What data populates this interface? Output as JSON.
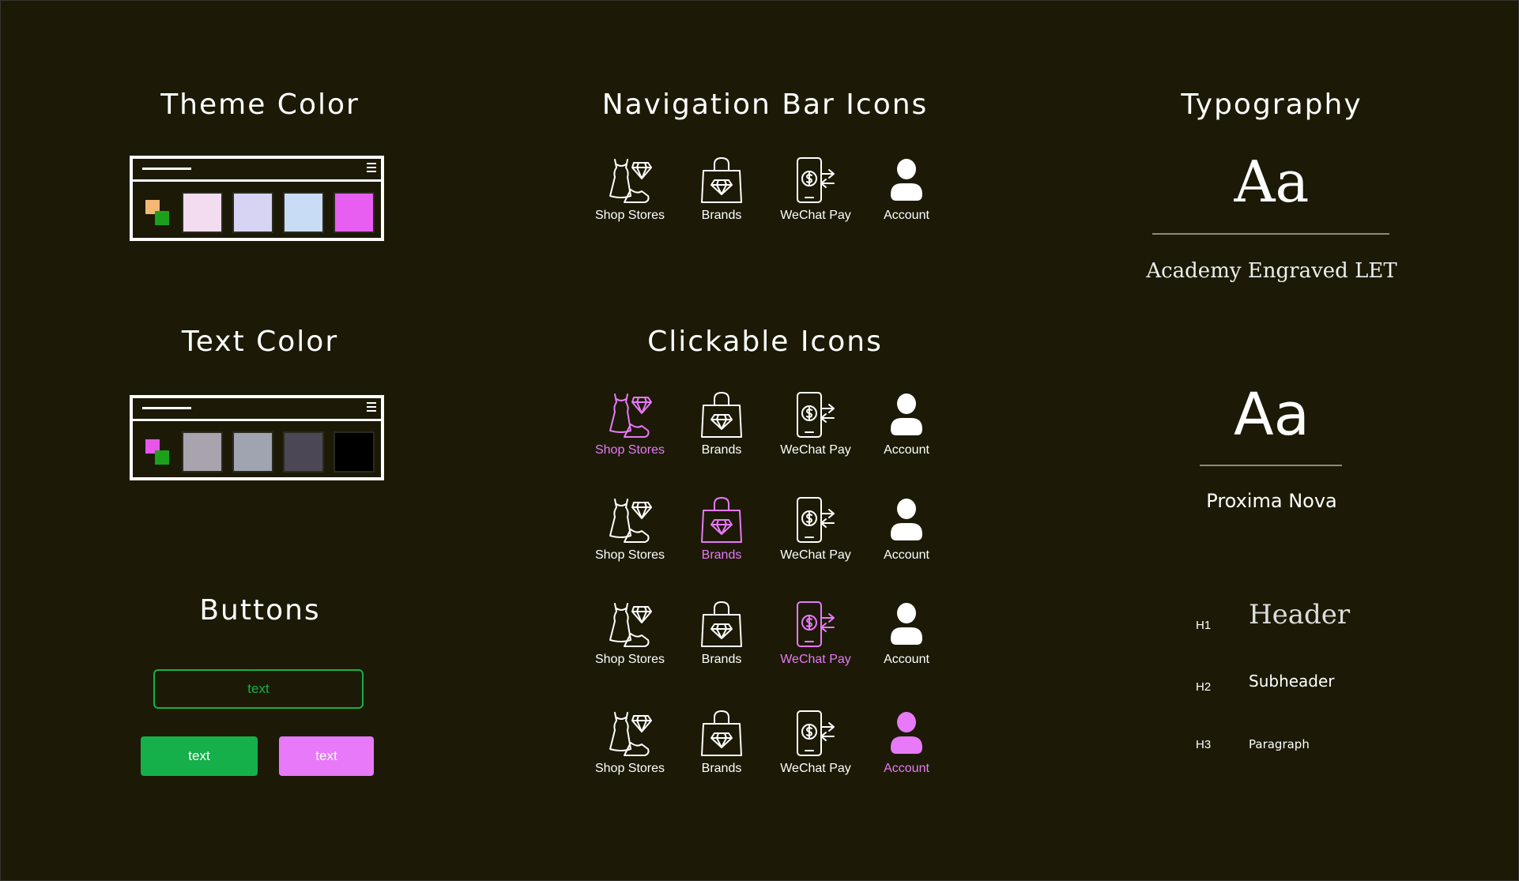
{
  "colors": {
    "background": "#1c1a06",
    "accent_pink": "#e879f9",
    "accent_green": "#16b04a",
    "white": "#ffffff"
  },
  "sections": {
    "theme_color": "Theme Color",
    "text_color": "Text Color",
    "buttons": "Buttons",
    "nav_icons": "Navigation Bar Icons",
    "clickable_icons": "Clickable Icons",
    "typography": "Typography"
  },
  "theme_palette": {
    "logo_color": "#f4b774",
    "swatches": [
      "#f3dcef",
      "#d6d4f2",
      "#c9dcf5",
      "#e85ef0"
    ]
  },
  "text_palette": {
    "logo_color": "#e855e8",
    "swatches": [
      "#a9a3ad",
      "#9fa4b0",
      "#4c4754",
      "#000000"
    ]
  },
  "buttons": {
    "outline_label": "text",
    "primary_label": "text",
    "secondary_label": "text"
  },
  "nav_icons": [
    {
      "label": "Shop Stores",
      "icon": "dress-shoe-icon"
    },
    {
      "label": "Brands",
      "icon": "diamond-bag-icon"
    },
    {
      "label": "WeChat Pay",
      "icon": "phone-pay-icon"
    },
    {
      "label": "Account",
      "icon": "person-icon"
    }
  ],
  "clickable_rows": [
    {
      "active": 0,
      "labels": [
        "Shop Stores",
        "Brands",
        "WeChat Pay",
        "Account"
      ]
    },
    {
      "active": 1,
      "labels": [
        "Shop Stores",
        "Brands",
        "WeChat Pay",
        "Account"
      ]
    },
    {
      "active": 2,
      "labels": [
        "Shop Stores",
        "Brands",
        "WeChat Pay",
        "Account"
      ]
    },
    {
      "active": 3,
      "labels": [
        "Shop Stores",
        "Brands",
        "WeChat Pay",
        "Account"
      ]
    }
  ],
  "typography": {
    "sample1": "Aa",
    "font1_name": "Academy Engraved LET",
    "sample2": "Aa",
    "font2_name": "Proxima Nova",
    "h1_label": "H1",
    "h1_text": "Header",
    "h2_label": "H2",
    "h2_text": "Subheader",
    "h3_label": "H3",
    "h3_text": "Paragraph"
  }
}
